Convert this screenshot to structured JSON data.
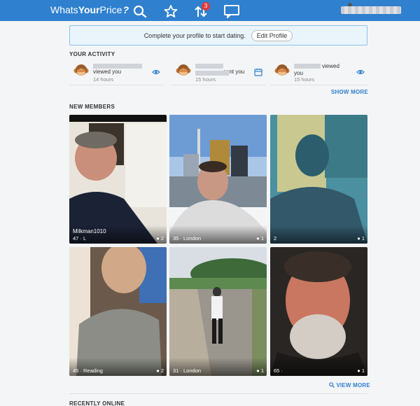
{
  "header": {
    "logo_prefix": "Whats",
    "logo_bold": "Your",
    "logo_suffix": "Price",
    "logo_mark": "?",
    "notification_count": "3"
  },
  "banner": {
    "text": "Complete your profile to start dating.",
    "button_label": "Edit Profile"
  },
  "activity": {
    "title": "YOUR ACTIVITY",
    "items": [
      {
        "text": "viewed you",
        "time": "14 hours",
        "icon": "eye-icon"
      },
      {
        "text": "sent you",
        "time": "15 hours",
        "icon": "calendar-icon"
      },
      {
        "text": "viewed",
        "text2": "you",
        "time": "15 hours",
        "icon": "eye-icon"
      }
    ],
    "show_more": "SHOW MORE"
  },
  "new_members": {
    "title": "NEW MEMBERS",
    "members": [
      {
        "name": "Milkman1010",
        "info": "47 · L",
        "count": "2"
      },
      {
        "name": "",
        "info": "35 · London",
        "count": "1"
      },
      {
        "name": "",
        "info": "2",
        "count": "1"
      },
      {
        "name": "",
        "info": "45 · Reading",
        "count": "2"
      },
      {
        "name": "",
        "info": "31 · London",
        "count": "1"
      },
      {
        "name": "",
        "info": "65 · ",
        "count": "1"
      }
    ],
    "view_more": "VIEW MORE"
  },
  "recently_online": {
    "title": "RECENTLY ONLINE"
  },
  "colors": {
    "topbar": "#2f80cf",
    "link": "#2f80cf",
    "badge": "#e03a3a"
  }
}
